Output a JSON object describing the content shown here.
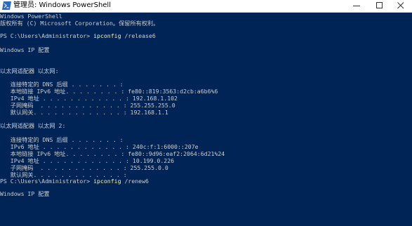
{
  "window": {
    "title": "管理员: Windows PowerShell"
  },
  "icons": {
    "app": "powershell-icon",
    "minimize": "minimize-icon",
    "maximize": "maximize-icon",
    "close": "close-icon"
  },
  "colors": {
    "console_bg": "#012456",
    "text": "#cccccc",
    "command": "#f9f1a5"
  },
  "console": {
    "header1": "Windows PowerShell",
    "header2": "版权所有 (C) Microsoft Corporation。保留所有权利。",
    "prompt1": "PS C:\\Users\\Administrator> ",
    "cmd1": "ipconfig",
    "arg1": " /release6",
    "ipconfig_title1": "Windows IP 配置",
    "adapter1": "以太网适配器 以太网:",
    "a1_dns_suffix": "   连接特定的 DNS 后缀 . . . . . . . :",
    "a1_link_local": "   本地链接 IPv6 地址. . . . . . . . : fe80::819:3563:d2cb:a6b6%6",
    "a1_ipv4": "   IPv4 地址 . . . . . . . . . . . . : 192.168.1.102",
    "a1_mask": "   子网掩码  . . . . . . . . . . . . : 255.255.255.0",
    "a1_gateway": "   默认网关. . . . . . . . . . . . . : 192.168.1.1",
    "adapter2": "以太网适配器 以太网 2:",
    "a2_dns_suffix": "   连接特定的 DNS 后缀 . . . . . . . :",
    "a2_ipv6": "   IPv6 地址 . . . . . . . . . . . . : 240c:f:1:6000::207e",
    "a2_link_local": "   本地链接 IPv6 地址. . . . . . . . : fe80::9d96:eaf2:2064:6d21%24",
    "a2_ipv4": "   IPv4 地址 . . . . . . . . . . . . : 10.199.0.226",
    "a2_mask": "   子网掩码  . . . . . . . . . . . . : 255.255.0.0",
    "a2_gateway": "   默认网关. . . . . . . . . . . . . :",
    "prompt2": "PS C:\\Users\\Administrator> ",
    "cmd2": "ipconfig",
    "arg2": " /renew6",
    "ipconfig_title2": "Windows IP 配置"
  }
}
